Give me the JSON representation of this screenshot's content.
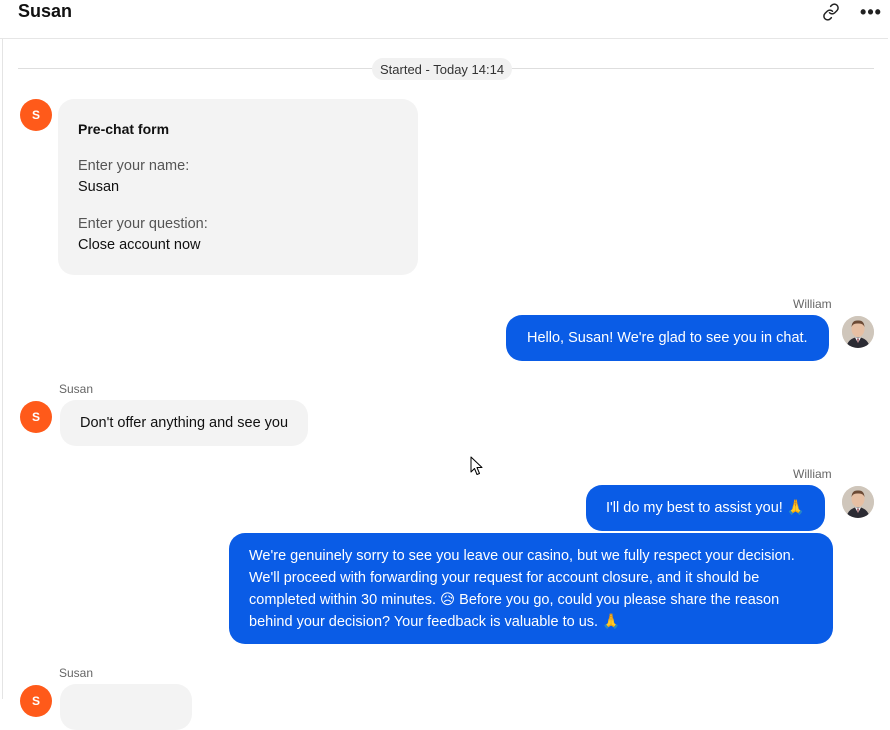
{
  "header": {
    "title": "Susan",
    "link_icon": "link-icon",
    "more_icon": "more-icon",
    "more_glyph": "•••"
  },
  "started_label": "Started - Today 14:14",
  "prechat": {
    "avatar_letter": "S",
    "title": "Pre-chat form",
    "name_label": "Enter your name:",
    "name_value": "Susan",
    "question_label": "Enter your question:",
    "question_value": "Close account now"
  },
  "messages": [
    {
      "sender": "William",
      "text": "Hello, Susan! We're glad to see you in chat."
    },
    {
      "sender": "Susan",
      "avatar_letter": "S",
      "text": "Don't offer anything and see you"
    },
    {
      "sender": "William",
      "text": "I'll do my best to assist you! 🙏"
    },
    {
      "text": "We're genuinely sorry to see you leave our casino, but we fully respect your decision. We'll proceed with forwarding your request for account closure, and it should be completed within 30 minutes. 😥 Before you go, could you please share the reason behind your decision? Your feedback is valuable to us. 🙏"
    },
    {
      "sender": "Susan",
      "avatar_letter": "S"
    }
  ],
  "colors": {
    "agent_bubble": "#0a5ce6",
    "visitor_bubble": "#f3f3f3",
    "visitor_avatar": "#ff5a1a"
  }
}
